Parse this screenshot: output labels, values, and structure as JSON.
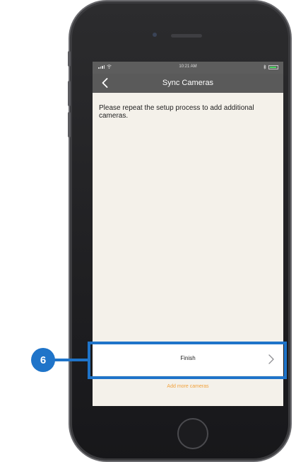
{
  "status_bar": {
    "time": "10:21 AM",
    "battery_level": 0.85
  },
  "nav": {
    "back_icon": "chevron-left-icon",
    "title": "Sync Cameras"
  },
  "content": {
    "instructions": "Please repeat the setup process to add additional cameras."
  },
  "finish_row": {
    "label": "Finish",
    "chevron_icon": "chevron-right-icon"
  },
  "add_more_link": "Add more cameras",
  "callout": {
    "number": "6"
  },
  "colors": {
    "accent_link": "#f2a23c",
    "callout_blue": "#1f74c9",
    "nav_bar": "#5a5a5a",
    "screen_background": "#f4f1ea"
  }
}
